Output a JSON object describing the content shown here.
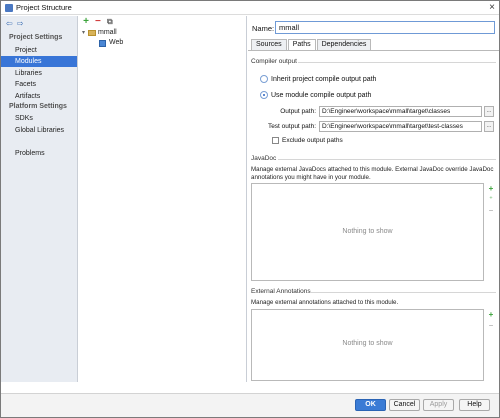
{
  "window": {
    "title": "Project Structure",
    "close_glyph": "×"
  },
  "nav": {
    "back_icon": "back-arrow-icon",
    "forward_icon": "forward-arrow-icon",
    "project_settings_header": "Project Settings",
    "platform_settings_header": "Platform Settings",
    "items": [
      {
        "label": "Project",
        "selected": false
      },
      {
        "label": "Modules",
        "selected": true
      },
      {
        "label": "Libraries",
        "selected": false
      },
      {
        "label": "Facets",
        "selected": false
      },
      {
        "label": "Artifacts",
        "selected": false
      }
    ],
    "platform_items": [
      {
        "label": "SDKs"
      },
      {
        "label": "Global Libraries"
      }
    ],
    "problems_label": "Problems"
  },
  "tree": {
    "toolbar": {
      "add": "+",
      "remove": "−",
      "copy": "⧉"
    },
    "root": {
      "label": "mmall",
      "caret": "▾"
    },
    "child": {
      "label": "Web"
    }
  },
  "module": {
    "name_label": "Name:",
    "name_value": "mmall",
    "tabs": [
      {
        "label": "Sources",
        "active": false
      },
      {
        "label": "Paths",
        "active": true
      },
      {
        "label": "Dependencies",
        "active": false
      }
    ],
    "compiler_output": {
      "title": "Compiler output",
      "inherit_label": "Inherit project compile output path",
      "use_module_label": "Use module compile output path",
      "output_path_label": "Output path:",
      "output_path_value": "D:\\Engineer\\workspace\\mmall\\target\\classes",
      "test_output_path_label": "Test output path:",
      "test_output_path_value": "D:\\Engineer\\workspace\\mmall\\target\\test-classes",
      "browse_label": "...",
      "exclude_label": "Exclude output paths"
    },
    "javadoc": {
      "title": "JavaDoc",
      "description": "Manage external JavaDocs attached to this module. External JavaDoc override JavaDoc annotations you might have in your module.",
      "empty_text": "Nothing to show",
      "add": "+",
      "add_url": "⁺",
      "remove": "−"
    },
    "external_annotations": {
      "title": "External Annotations",
      "description": "Manage external annotations attached to this module.",
      "empty_text": "Nothing to show",
      "add": "+",
      "remove": "−"
    }
  },
  "buttons": {
    "ok": "OK",
    "cancel": "Cancel",
    "apply": "Apply",
    "help": "Help"
  }
}
